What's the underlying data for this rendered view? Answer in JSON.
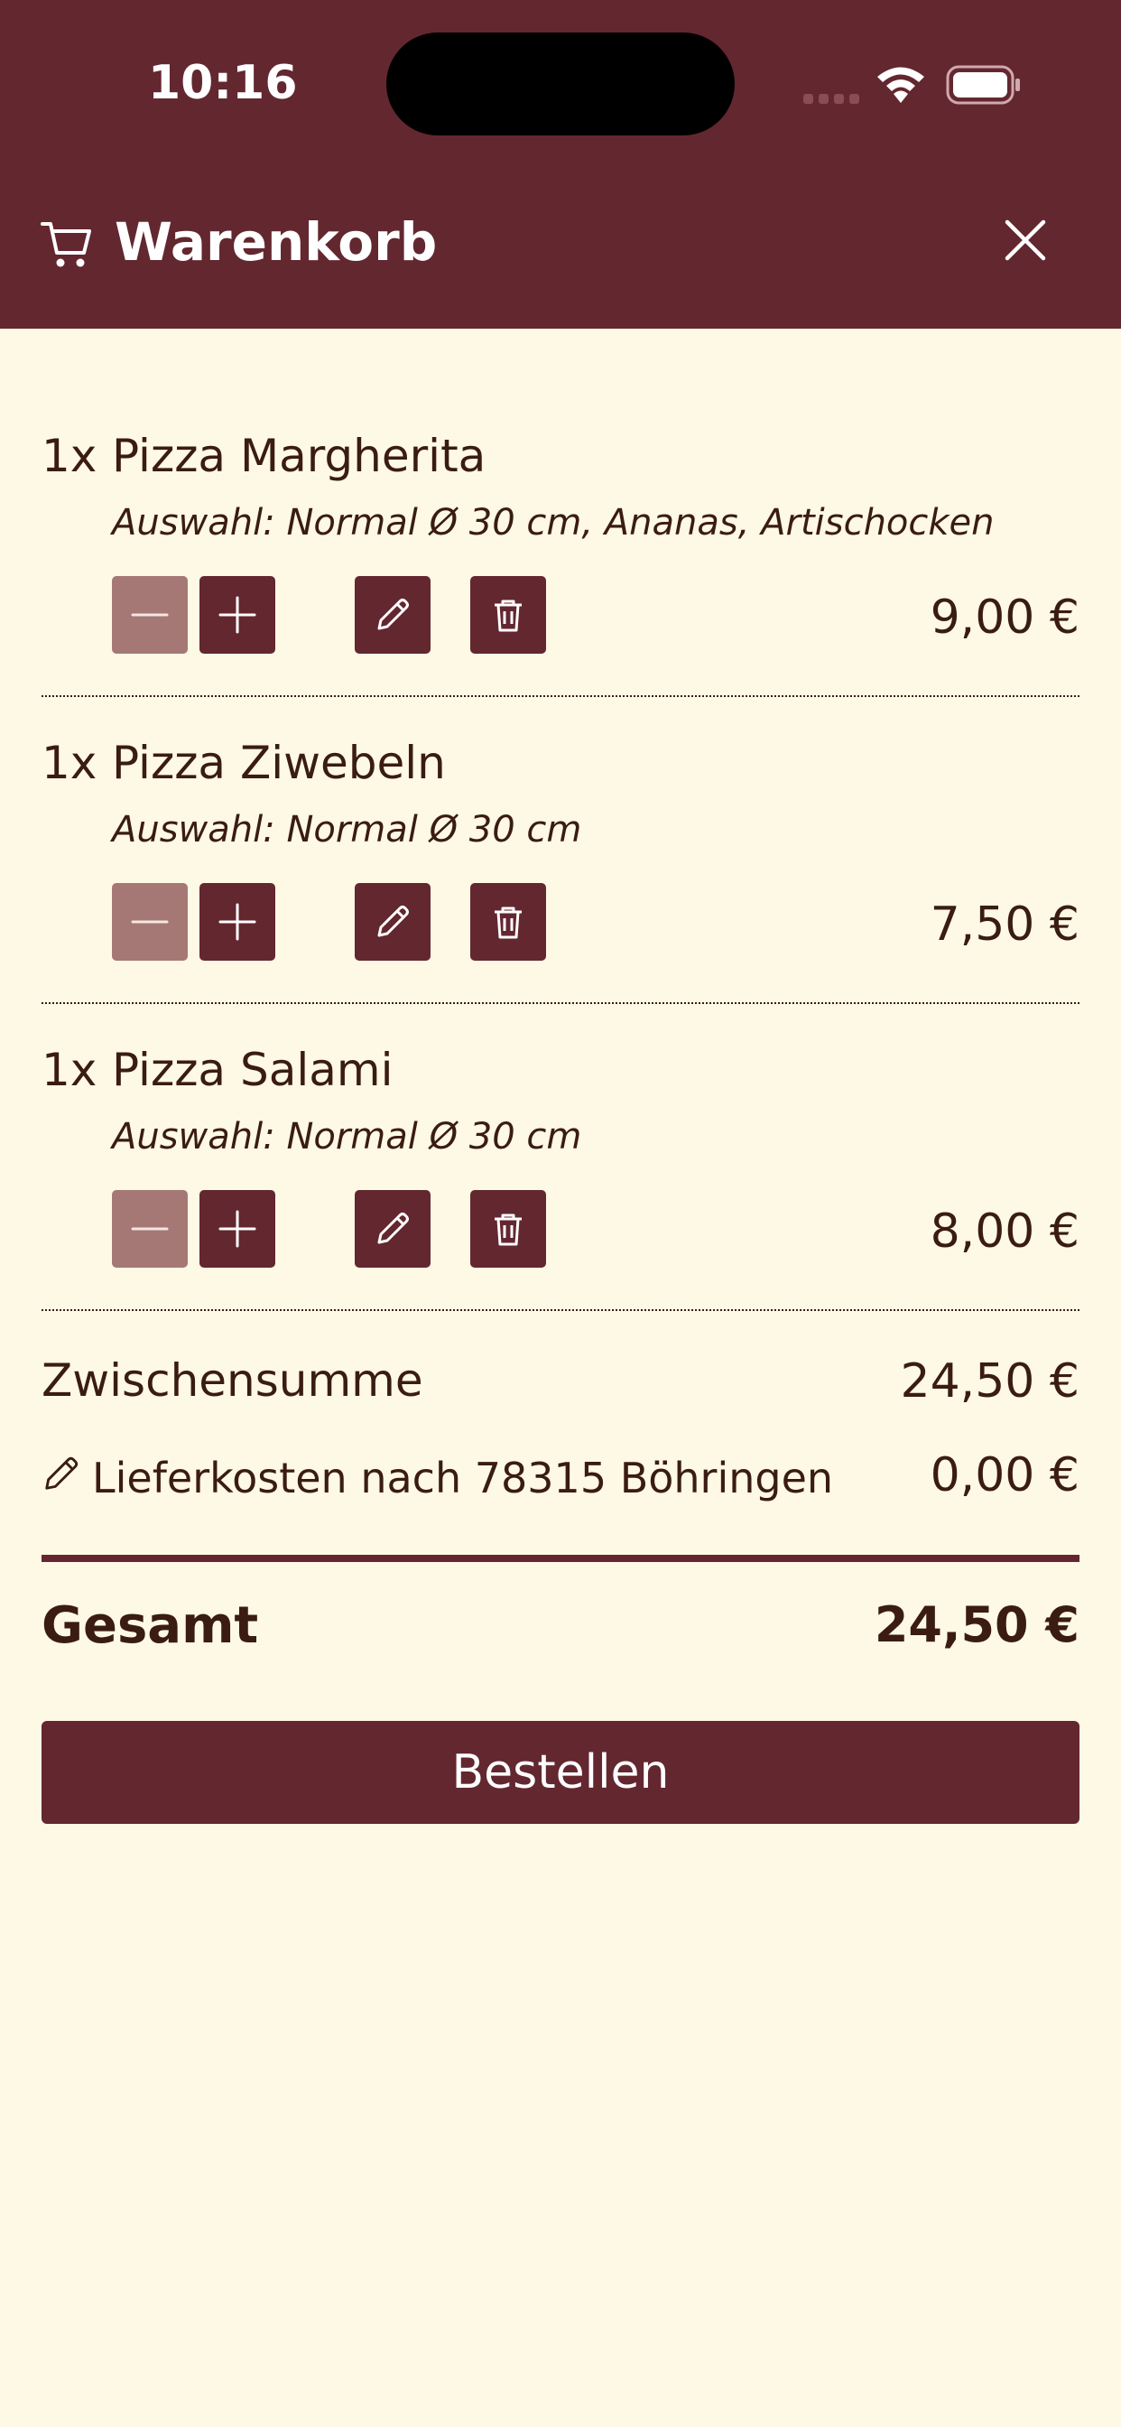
{
  "status_bar": {
    "time": "10:16"
  },
  "header": {
    "title": "Warenkorb",
    "cart_icon": "cart-icon",
    "close_icon": "close-icon"
  },
  "items": [
    {
      "qty": "1x",
      "name": "Pizza Margherita",
      "selection": "Auswahl: Normal Ø 30 cm, Ananas, Artischocken",
      "price": "9,00 €"
    },
    {
      "qty": "1x",
      "name": "Pizza Ziwebeln",
      "selection": "Auswahl: Normal Ø 30 cm",
      "price": "7,50 €"
    },
    {
      "qty": "1x",
      "name": "Pizza Salami",
      "selection": "Auswahl: Normal Ø 30 cm",
      "price": "8,00 €"
    }
  ],
  "summary": {
    "subtotal_label": "Zwischensumme",
    "subtotal_value": "24,50 €",
    "delivery_label": "Lieferkosten nach 78315 Böhringen",
    "delivery_value": "0,00 €",
    "total_label": "Gesamt",
    "total_value": "24,50 €"
  },
  "order_button": "Bestellen",
  "colors": {
    "primary": "#632730",
    "background": "#fef9e4",
    "disabled": "#a57876",
    "text": "#3a1c12"
  }
}
